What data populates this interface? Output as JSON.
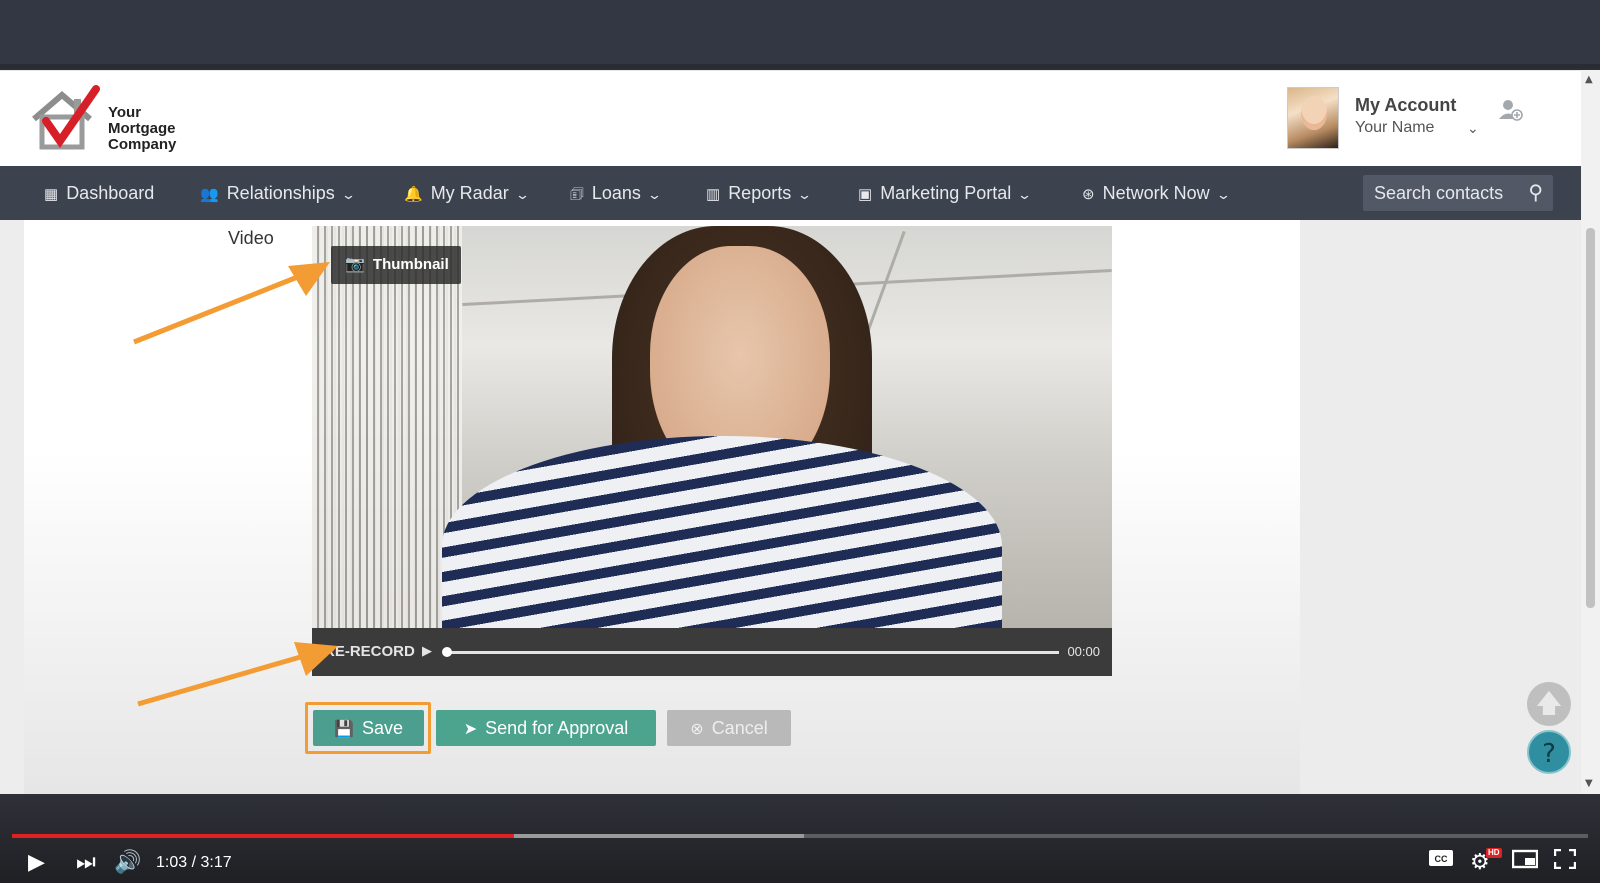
{
  "brand": {
    "logo_lines": [
      "Your",
      "Mortgage",
      "Company"
    ]
  },
  "account": {
    "title": "My Account",
    "name": "Your Name"
  },
  "nav": {
    "items": [
      {
        "label": "Dashboard",
        "icon": "dashboard-icon"
      },
      {
        "label": "Relationships",
        "icon": "people-icon"
      },
      {
        "label": "My Radar",
        "icon": "bell-icon"
      },
      {
        "label": "Loans",
        "icon": "loans-icon"
      },
      {
        "label": "Reports",
        "icon": "bar-chart-icon"
      },
      {
        "label": "Marketing Portal",
        "icon": "storefront-icon"
      },
      {
        "label": "Network Now",
        "icon": "network-icon"
      }
    ],
    "search_placeholder": "Search contacts"
  },
  "form": {
    "video_label": "Video",
    "thumbnail_button": "Thumbnail",
    "rerecord": "RE-RECORD",
    "time": "00:00",
    "buttons": {
      "save": "Save",
      "send": "Send for Approval",
      "cancel": "Cancel"
    }
  },
  "annotation_color": "#f39c33",
  "player": {
    "time": "1:03 / 3:17",
    "played_fraction": 0.3183,
    "buffered_fraction": 0.5025
  }
}
